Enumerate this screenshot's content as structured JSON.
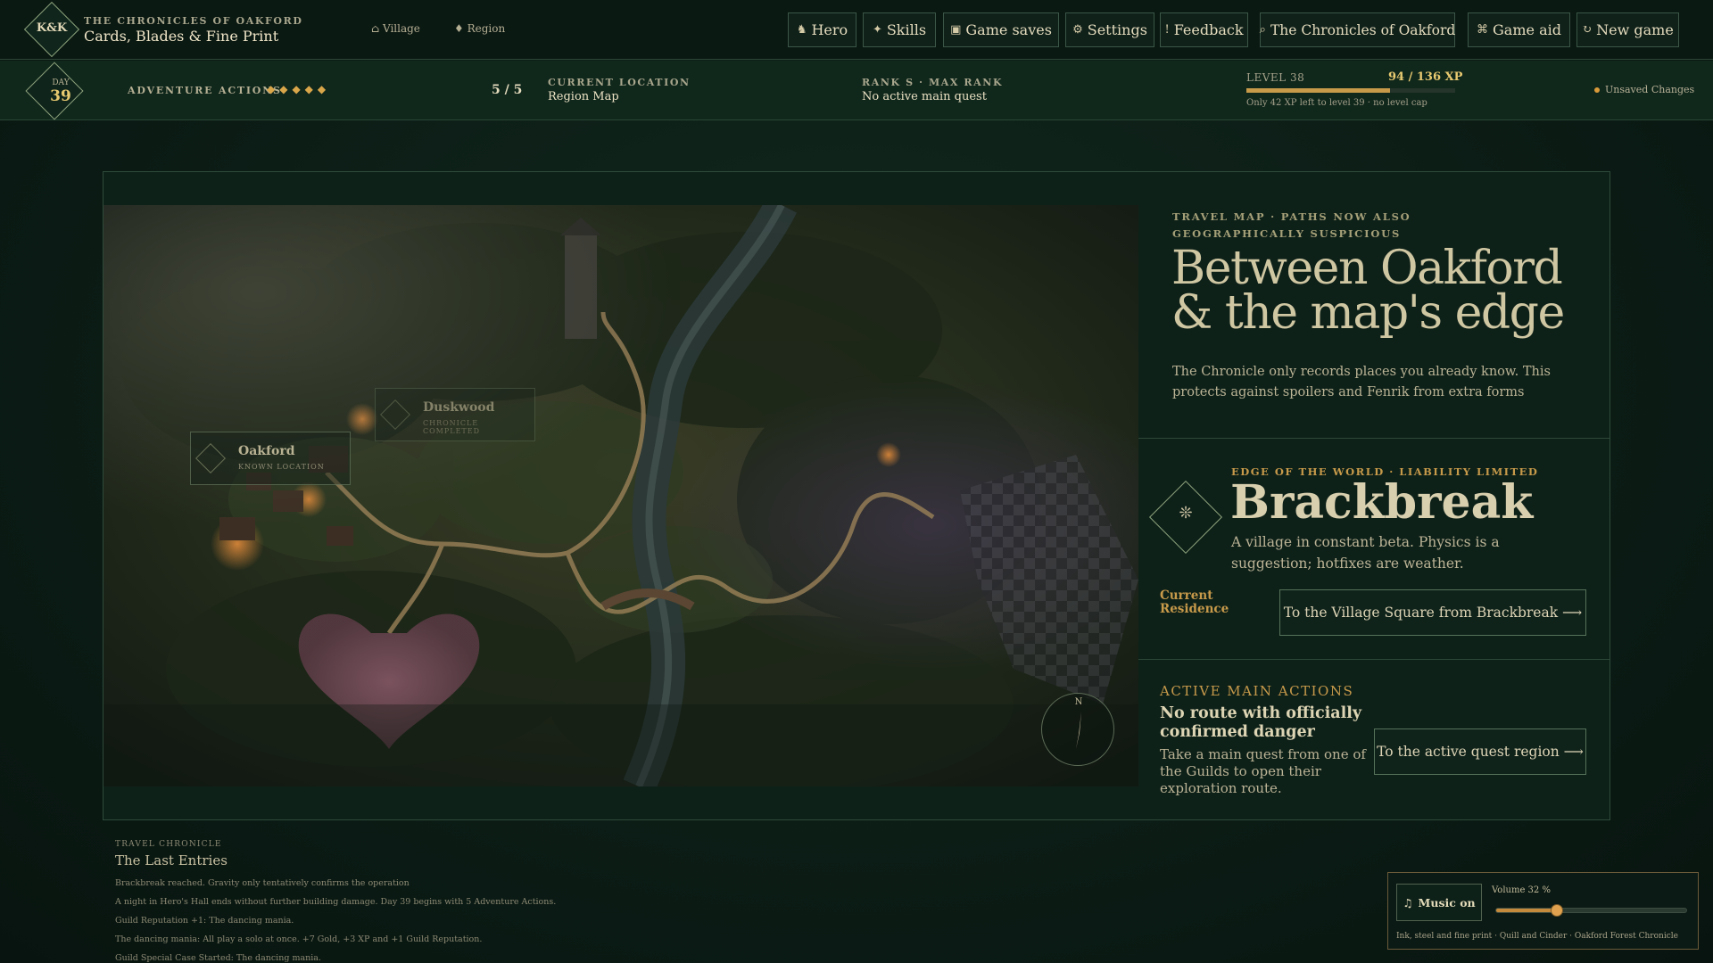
{
  "header": {
    "logo": "K&K",
    "subtitle": "THE CHRONICLES OF OAKFORD",
    "title": "Cards, Blades & Fine Print",
    "crumbs": [
      {
        "icon": "⌂",
        "label": "Village"
      },
      {
        "icon": "♦",
        "label": "Region"
      }
    ],
    "nav": [
      {
        "icon": "♞",
        "label": "Hero"
      },
      {
        "icon": "✦",
        "label": "Skills"
      },
      {
        "icon": "▣",
        "label": "Game saves"
      },
      {
        "icon": "⚙",
        "label": "Settings"
      },
      {
        "icon": "!",
        "label": "Feedback"
      },
      {
        "icon": "⌕",
        "label": "The Chronicles of Oakford"
      },
      {
        "icon": "⌘",
        "label": "Game aid"
      },
      {
        "icon": "↻",
        "label": "New game"
      }
    ]
  },
  "status": {
    "day_label": "DAY",
    "day": "39",
    "actions_label": "ADVENTURE ACTIONS",
    "actions_pips": "◆◆◆◆◆",
    "actions_count": "5 / 5",
    "location_label": "CURRENT LOCATION",
    "location": "Region Map",
    "rank_label": "RANK S · MAX RANK",
    "rank_value": "No active main quest",
    "level": "LEVEL 38",
    "xp": "94 / 136 XP",
    "xp_fraction": 0.69,
    "xp_note": "Only 42 XP left to level 39 · no level cap",
    "unsaved": "Unsaved Changes"
  },
  "map": {
    "locations": [
      {
        "name": "Oakford",
        "sub": "KNOWN LOCATION"
      },
      {
        "name": "Duskwood",
        "sub": "CHRONICLE COMPLETED"
      }
    ],
    "compass": "N"
  },
  "panel": {
    "caption": "TRAVEL MAP · PATHS NOW ALSO GEOGRAPHICALLY SUSPICIOUS",
    "title": "Between Oakford & the map's edge",
    "desc": "The Chronicle only records places you already know. This protects against spoilers and Fenrik from extra forms",
    "village": {
      "icon": "❊",
      "caption": "EDGE OF THE WORLD · LIABILITY LIMITED",
      "name": "Brackbreak",
      "desc": "A village in constant beta. Physics is a suggestion; hotfixes are weather.",
      "residence": "Current Residence",
      "button": "To the Village Square from Brackbreak ⟶"
    },
    "main_actions": {
      "caption": "ACTIVE MAIN ACTIONS",
      "title": "No route with officially confirmed danger",
      "desc": "Take a main quest from one of the Guilds to open their exploration route.",
      "button": "To the active quest region ⟶"
    }
  },
  "chronicle": {
    "caption": "TRAVEL CHRONICLE",
    "title": "The Last Entries",
    "entries": [
      "Brackbreak reached. Gravity only tentatively confirms the operation",
      "A night in Hero's Hall ends without further building damage. Day 39 begins with 5 Adventure Actions.",
      "Guild Reputation +1: The dancing mania.",
      "The dancing mania: All play a solo at once. +7 Gold, +3 XP and +1 Guild Reputation.",
      "Guild Special Case Started: The dancing mania."
    ]
  },
  "music": {
    "button": "Music on",
    "icon": "♫",
    "volume_label": "Volume 32 %",
    "volume": 0.32,
    "footer": "Ink, steel and fine print · Quill and Cinder · Oakford Forest Chronicle"
  },
  "colors": {
    "accent": "#c79a4a",
    "gold": "#e8ca70",
    "panel": "#0e2119",
    "border": "#2e4a3a"
  }
}
